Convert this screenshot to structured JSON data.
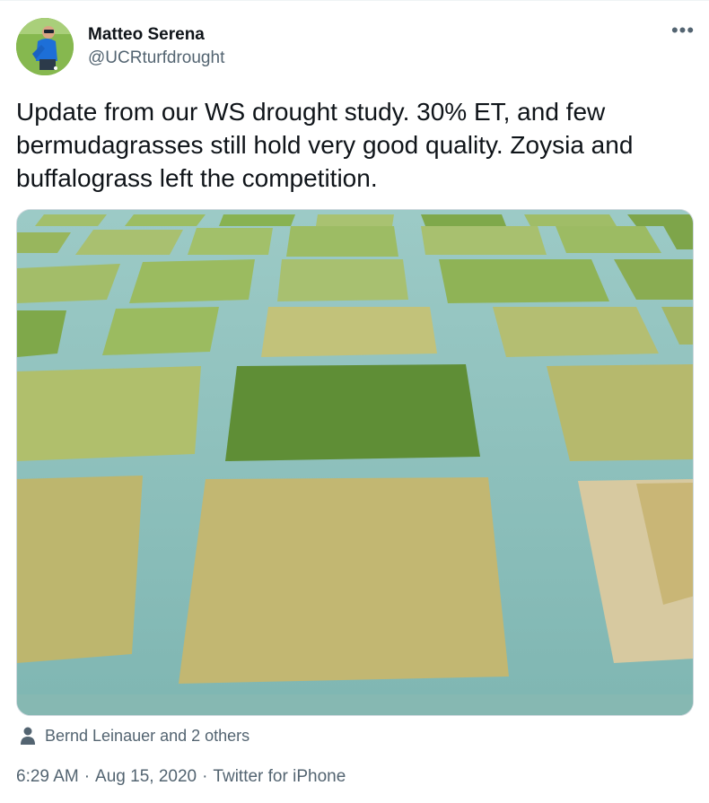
{
  "tweet": {
    "author_name": "Matteo Serena",
    "author_handle": "@UCRturfdrought",
    "more_icon": "more-dots-icon",
    "text": "Update from our WS drought study. 30% ET, and few bermudagrasses still hold very good quality. Zoysia and buffalograss left the competition.",
    "media_alt": "Turfgrass drought study plots",
    "tagged_icon": "person-icon",
    "tagged_text": "Bernd Leinauer and 2 others",
    "time": "6:29 AM",
    "date": "Aug 15, 2020",
    "source": "Twitter for iPhone",
    "separator": "·"
  },
  "colors": {
    "text_primary": "#0f1419",
    "text_secondary": "#536471",
    "border": "#cfd9de"
  }
}
